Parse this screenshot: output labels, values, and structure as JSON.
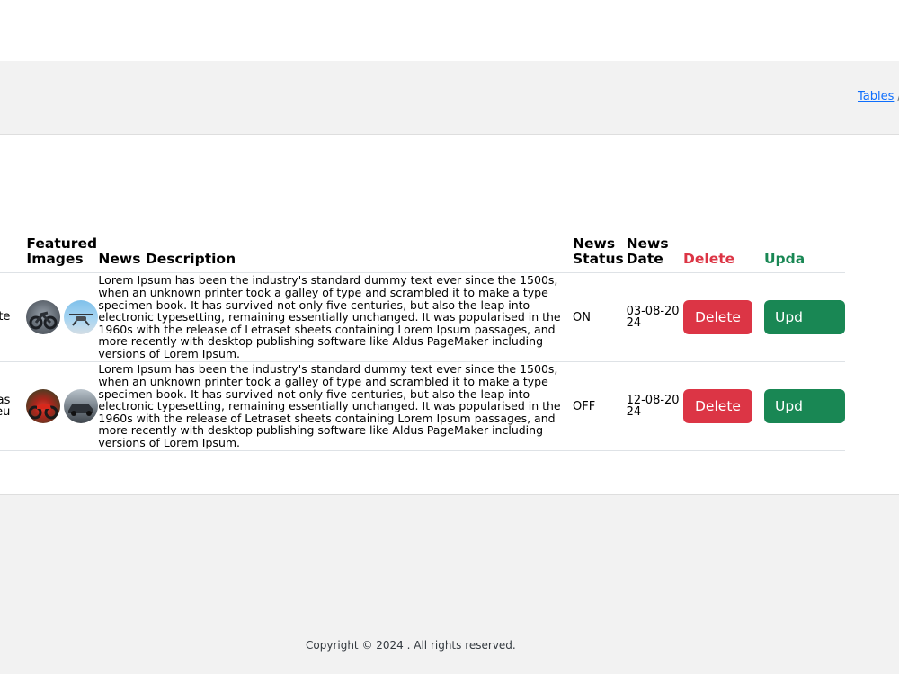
{
  "breadcrumb": {
    "link": "Tables",
    "separator": "/"
  },
  "table": {
    "headers": {
      "images": "Featured Images",
      "description": "News Description",
      "status": "News Status",
      "date": "News Date",
      "delete": "Delete",
      "update": "Upda"
    },
    "rows": [
      {
        "title": "te",
        "images": [
          "motorbike-thumbnail",
          "drone-thumbnail"
        ],
        "description": "Lorem Ipsum has been the industry's standard dummy text ever since the 1500s, when an unknown printer took a galley of type and scrambled it to make a type specimen book. It has survived not only five centuries, but also the leap into electronic typesetting, remaining essentially unchanged. It was popularised in the 1960s with the release of Letraset sheets containing Lorem Ipsum passages, and more recently with desktop publishing software like Aldus PageMaker including versions of Lorem Ipsum.",
        "status": "ON",
        "date": "03-08-2024",
        "delete_label": "Delete",
        "update_label": "Upd"
      },
      {
        "title": "as\neu",
        "images": [
          "motorcycle-thumbnail",
          "car-thumbnail"
        ],
        "description": "Lorem Ipsum has been the industry's standard dummy text ever since the 1500s, when an unknown printer took a galley of type and scrambled it to make a type specimen book. It has survived not only five centuries, but also the leap into electronic typesetting, remaining essentially unchanged. It was popularised in the 1960s with the release of Letraset sheets containing Lorem Ipsum passages, and more recently with desktop publishing software like Aldus PageMaker including versions of Lorem Ipsum.",
        "status": "OFF",
        "date": "12-08-2024",
        "delete_label": "Delete",
        "update_label": "Upd"
      }
    ]
  },
  "colors": {
    "delete": "#dc3545",
    "update": "#198754",
    "link": "#0d6efd",
    "band": "#f2f2f2"
  },
  "footer": {
    "copyright": "Copyright © 2024 . All rights reserved."
  }
}
